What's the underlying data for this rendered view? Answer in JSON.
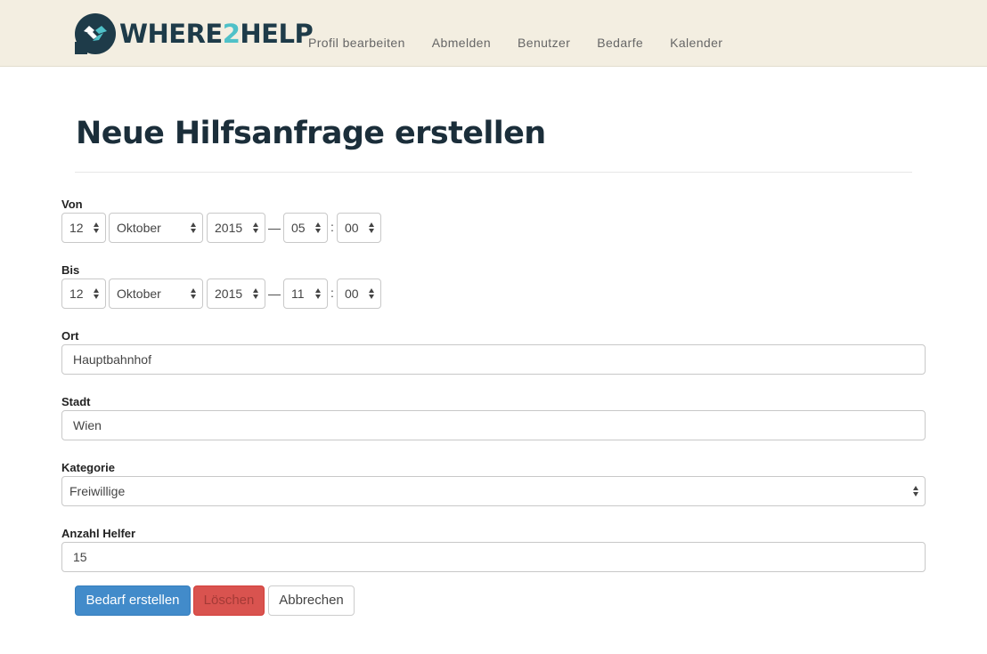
{
  "brand": {
    "text_a": "WHERE",
    "text_num": "2",
    "text_b": "HELP"
  },
  "nav": [
    {
      "label": "Profil bearbeiten"
    },
    {
      "label": "Abmelden"
    },
    {
      "label": "Benutzer"
    },
    {
      "label": "Bedarfe"
    },
    {
      "label": "Kalender"
    }
  ],
  "page": {
    "title": "Neue Hilfsanfrage erstellen"
  },
  "form": {
    "von": {
      "label": "Von",
      "day": "12",
      "month": "Oktober",
      "year": "2015",
      "dash": "—",
      "hour": "05",
      "colon": ":",
      "minute": "00"
    },
    "bis": {
      "label": "Bis",
      "day": "12",
      "month": "Oktober",
      "year": "2015",
      "dash": "—",
      "hour": "11",
      "colon": ":",
      "minute": "00"
    },
    "ort": {
      "label": "Ort",
      "value": "Hauptbahnhof"
    },
    "stadt": {
      "label": "Stadt",
      "value": "Wien"
    },
    "kategorie": {
      "label": "Kategorie",
      "value": "Freiwillige"
    },
    "anzahl": {
      "label": "Anzahl Helfer",
      "value": "15"
    }
  },
  "buttons": {
    "create": "Bedarf erstellen",
    "delete": "Löschen",
    "cancel": "Abbrechen"
  },
  "colors": {
    "navbar": "#f3eee1",
    "brand_dark": "#1e3b49",
    "brand_accent": "#4fc1c8",
    "primary": "#428bca",
    "danger": "#d9534f"
  }
}
